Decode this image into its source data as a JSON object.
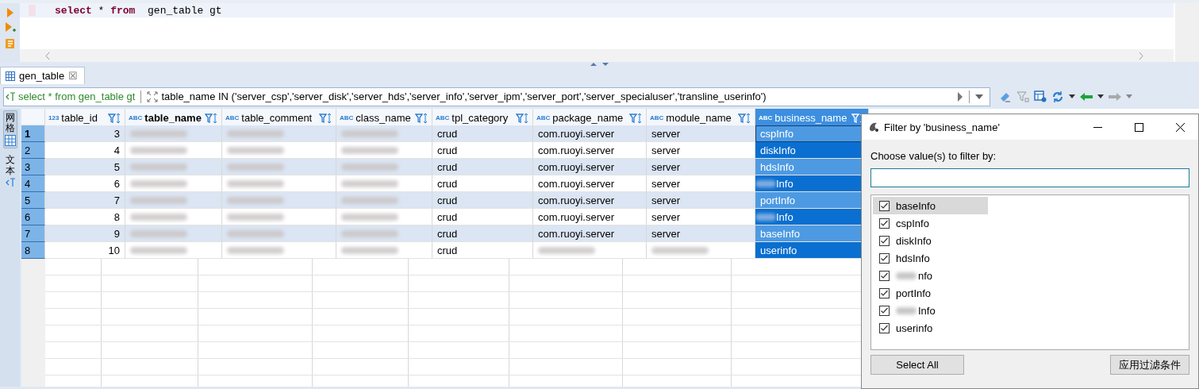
{
  "editor": {
    "tokens": [
      {
        "text": "select",
        "kind": "keyword"
      },
      {
        "text": " * ",
        "kind": "plain"
      },
      {
        "text": "from",
        "kind": "keyword"
      },
      {
        "text": "  gen_table gt",
        "kind": "plain"
      }
    ]
  },
  "results_tab": {
    "label": "gen_table",
    "close": "☒"
  },
  "filter_bar": {
    "query": "select * from gen_table gt",
    "filter": "table_name IN ('server_csp','server_disk','server_hds','server_info','server_ipm','server_port','server_specialuser','transline_userinfo')"
  },
  "side_tabs": [
    {
      "label": "网格",
      "selected": true
    },
    {
      "label": "文本",
      "selected": false
    }
  ],
  "table": {
    "columns": [
      {
        "name": "table_id",
        "type_label": "123",
        "numeric": true,
        "key": false,
        "selected": false
      },
      {
        "name": "table_name",
        "type_label": "ABC",
        "numeric": false,
        "key": true,
        "selected": false
      },
      {
        "name": "table_comment",
        "type_label": "ABC",
        "numeric": false,
        "key": false,
        "selected": false
      },
      {
        "name": "class_name",
        "type_label": "ABC",
        "numeric": false,
        "key": false,
        "selected": false
      },
      {
        "name": "tpl_category",
        "type_label": "ABC",
        "numeric": false,
        "key": false,
        "selected": false
      },
      {
        "name": "package_name",
        "type_label": "ABC",
        "numeric": false,
        "key": false,
        "selected": false
      },
      {
        "name": "module_name",
        "type_label": "ABC",
        "numeric": false,
        "key": false,
        "selected": false
      },
      {
        "name": "business_name",
        "type_label": "ABC",
        "numeric": false,
        "key": false,
        "selected": true
      }
    ],
    "rows": [
      {
        "number": "1",
        "current": true,
        "cells": [
          "3",
          {
            "kind": "redacted"
          },
          {
            "kind": "redacted"
          },
          {
            "kind": "redacted"
          },
          "crud",
          "com.ruoyi.server",
          "server",
          "cspInfo"
        ]
      },
      {
        "number": "2",
        "current": false,
        "cells": [
          "4",
          {
            "kind": "redacted"
          },
          {
            "kind": "redacted"
          },
          {
            "kind": "redacted"
          },
          "crud",
          "com.ruoyi.server",
          "server",
          "diskInfo"
        ]
      },
      {
        "number": "3",
        "current": false,
        "cells": [
          "5",
          {
            "kind": "redacted"
          },
          {
            "kind": "redacted"
          },
          {
            "kind": "redacted"
          },
          "crud",
          "com.ruoyi.server",
          "server",
          "hdsInfo"
        ]
      },
      {
        "number": "4",
        "current": false,
        "cells": [
          "6",
          {
            "kind": "redacted"
          },
          {
            "kind": "redacted"
          },
          {
            "kind": "redacted"
          },
          "crud",
          "com.ruoyi.server",
          "server",
          {
            "kind": "partly_redacted",
            "text": "Info"
          }
        ]
      },
      {
        "number": "5",
        "current": false,
        "cells": [
          "7",
          {
            "kind": "redacted"
          },
          {
            "kind": "redacted"
          },
          {
            "kind": "redacted"
          },
          "crud",
          "com.ruoyi.server",
          "server",
          "portInfo"
        ]
      },
      {
        "number": "6",
        "current": false,
        "cells": [
          "8",
          {
            "kind": "redacted"
          },
          {
            "kind": "redacted"
          },
          {
            "kind": "redacted"
          },
          "crud",
          "com.ruoyi.server",
          "server",
          {
            "kind": "partly_redacted",
            "text": "Info"
          }
        ]
      },
      {
        "number": "7",
        "current": false,
        "cells": [
          "9",
          {
            "kind": "redacted"
          },
          {
            "kind": "redacted"
          },
          {
            "kind": "redacted"
          },
          "crud",
          "com.ruoyi.server",
          "server",
          "baseInfo"
        ]
      },
      {
        "number": "8",
        "current": false,
        "cells": [
          "10",
          {
            "kind": "redacted"
          },
          {
            "kind": "redacted"
          },
          {
            "kind": "redacted"
          },
          "crud",
          {
            "kind": "redacted"
          },
          {
            "kind": "redacted"
          },
          "userinfo"
        ]
      }
    ]
  },
  "dialog": {
    "title": "Filter by 'business_name'",
    "prompt": "Choose value(s) to filter by:",
    "items": [
      {
        "text": "baseInfo",
        "checked": true,
        "selected": true,
        "redacted_prefix": false
      },
      {
        "text": "cspInfo",
        "checked": true,
        "selected": false,
        "redacted_prefix": false
      },
      {
        "text": "diskInfo",
        "checked": true,
        "selected": false,
        "redacted_prefix": false
      },
      {
        "text": "hdsInfo",
        "checked": true,
        "selected": false,
        "redacted_prefix": false
      },
      {
        "text": "nfo",
        "checked": true,
        "selected": false,
        "redacted_prefix": true
      },
      {
        "text": "portInfo",
        "checked": true,
        "selected": false,
        "redacted_prefix": false
      },
      {
        "text": "Info",
        "checked": true,
        "selected": false,
        "redacted_prefix": true
      },
      {
        "text": "userinfo",
        "checked": true,
        "selected": false,
        "redacted_prefix": false
      }
    ],
    "buttons": [
      "Select All",
      "应用过滤条件"
    ]
  }
}
